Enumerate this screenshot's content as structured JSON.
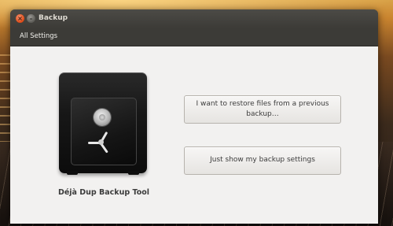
{
  "window": {
    "title": "Backup",
    "close_glyph": "×",
    "minimize_glyph": "–"
  },
  "toolbar": {
    "all_settings_label": "All Settings"
  },
  "main": {
    "app_name": "Déjà Dup Backup Tool",
    "restore_button_label": "I want to restore files from a previous backup…",
    "settings_button_label": "Just show my backup settings"
  },
  "icons": {
    "app_icon": "safe-icon",
    "close": "close-icon",
    "minimize": "minimize-icon"
  },
  "colors": {
    "close_button": "#dd4814",
    "titlebar": "#3c3b37",
    "content_background": "#f2f1f0"
  }
}
